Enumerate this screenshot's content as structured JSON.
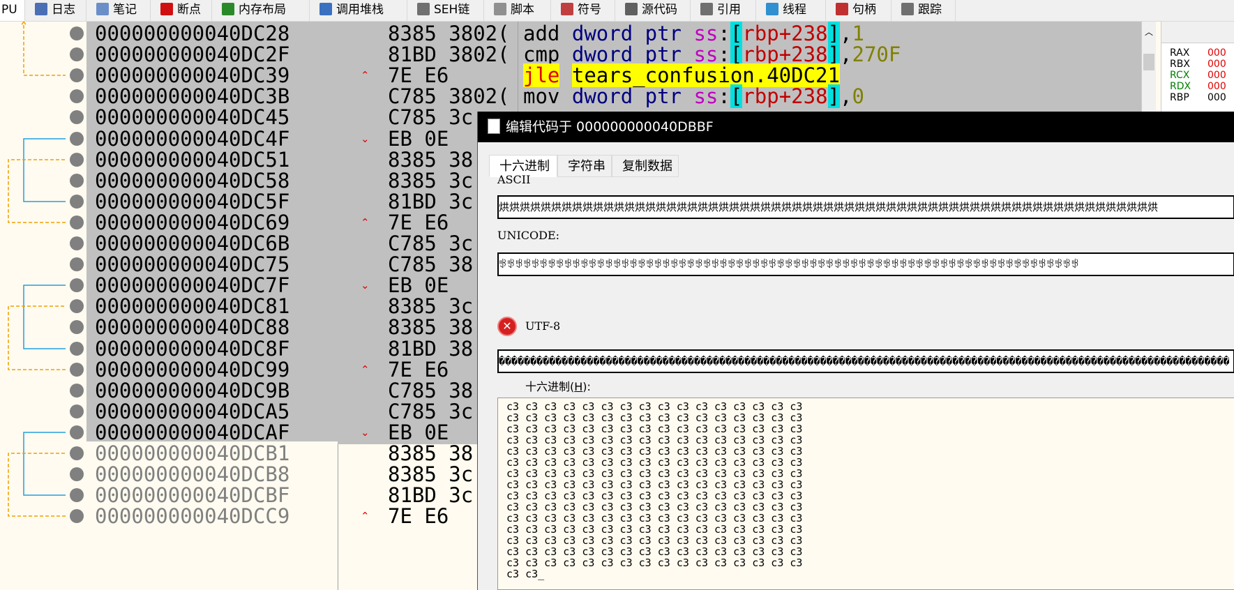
{
  "tabbar": {
    "first_label": "PU",
    "tabs": [
      {
        "label": "日志",
        "icon": "log-icon",
        "color": "#4a6fb5"
      },
      {
        "label": "笔记",
        "icon": "notes-icon",
        "color": "#6a8fc8"
      },
      {
        "label": "断点",
        "icon": "breakpoint-icon",
        "color": "#d01010"
      },
      {
        "label": "内存布局",
        "icon": "memory-map-icon",
        "color": "#2a8a2a"
      },
      {
        "label": "调用堆栈",
        "icon": "call-stack-icon",
        "color": "#3a70c0"
      },
      {
        "label": "SEH链",
        "icon": "seh-chain-icon",
        "color": "#707070"
      },
      {
        "label": "脚本",
        "icon": "script-icon",
        "color": "#909090"
      },
      {
        "label": "符号",
        "icon": "symbols-icon",
        "color": "#c04040"
      },
      {
        "label": "源代码",
        "icon": "source-icon",
        "color": "#606060"
      },
      {
        "label": "引用",
        "icon": "references-icon",
        "color": "#707070"
      },
      {
        "label": "线程",
        "icon": "threads-icon",
        "color": "#3090d0"
      },
      {
        "label": "句柄",
        "icon": "handles-icon",
        "color": "#c03030"
      },
      {
        "label": "跟踪",
        "icon": "trace-icon",
        "color": "#707070"
      }
    ]
  },
  "disasm": {
    "rows": [
      {
        "addr": "000000000040DC28",
        "bytes": "8385 3802(",
        "sel": true
      },
      {
        "addr": "000000000040DC2F",
        "bytes": "81BD 3802(",
        "sel": true
      },
      {
        "addr": "000000000040DC39",
        "bytes": "7E E6",
        "sel": true,
        "mark": "^"
      },
      {
        "addr": "000000000040DC3B",
        "bytes": "C785 3802(",
        "sel": true
      },
      {
        "addr": "000000000040DC45",
        "bytes": "C785 3c",
        "sel": true
      },
      {
        "addr": "000000000040DC4F",
        "bytes": "EB 0E",
        "sel": true,
        "mark": "v"
      },
      {
        "addr": "000000000040DC51",
        "bytes": "8385 38",
        "sel": true
      },
      {
        "addr": "000000000040DC58",
        "bytes": "8385 3c",
        "sel": true
      },
      {
        "addr": "000000000040DC5F",
        "bytes": "81BD 3c",
        "sel": true
      },
      {
        "addr": "000000000040DC69",
        "bytes": "7E E6",
        "sel": true,
        "mark": "^"
      },
      {
        "addr": "000000000040DC6B",
        "bytes": "C785 3c",
        "sel": true
      },
      {
        "addr": "000000000040DC75",
        "bytes": "C785 38",
        "sel": true
      },
      {
        "addr": "000000000040DC7F",
        "bytes": "EB 0E",
        "sel": true,
        "mark": "v"
      },
      {
        "addr": "000000000040DC81",
        "bytes": "8385 3c",
        "sel": true
      },
      {
        "addr": "000000000040DC88",
        "bytes": "8385 38",
        "sel": true
      },
      {
        "addr": "000000000040DC8F",
        "bytes": "81BD 38",
        "sel": true
      },
      {
        "addr": "000000000040DC99",
        "bytes": "7E E6",
        "sel": true,
        "mark": "^"
      },
      {
        "addr": "000000000040DC9B",
        "bytes": "C785 38",
        "sel": true
      },
      {
        "addr": "000000000040DCA5",
        "bytes": "C785 3c",
        "sel": true
      },
      {
        "addr": "000000000040DCAF",
        "bytes": "EB 0E",
        "sel": true,
        "mark": "v"
      },
      {
        "addr": "000000000040DCB1",
        "bytes": "8385 38",
        "sel": false
      },
      {
        "addr": "000000000040DCB8",
        "bytes": "8385 3c",
        "sel": false
      },
      {
        "addr": "000000000040DCBF",
        "bytes": "81BD 3c",
        "sel": false
      },
      {
        "addr": "000000000040DCC9",
        "bytes": "7E E6",
        "sel": false,
        "mark": "^"
      }
    ],
    "instructions": {
      "i0": {
        "mnemonic": "add",
        "size": "dword ptr",
        "seg": "ss",
        "reg": "rbp+238",
        "val": "1"
      },
      "i1": {
        "mnemonic": "cmp",
        "size": "dword ptr",
        "seg": "ss",
        "reg": "rbp+238",
        "val": "270F"
      },
      "i2": {
        "mnemonic": "jle",
        "target": "tears_confusion.40DC21"
      },
      "i3": {
        "mnemonic": "mov",
        "size": "dword ptr",
        "seg": "ss",
        "reg": "rbp+238",
        "val": "0"
      }
    }
  },
  "registers": [
    {
      "name": "RAX",
      "value": "000",
      "color": "#000000"
    },
    {
      "name": "RBX",
      "value": "000",
      "color": "#000000"
    },
    {
      "name": "RCX",
      "value": "000",
      "color": "#008000"
    },
    {
      "name": "RDX",
      "value": "000",
      "color": "#008000"
    },
    {
      "name": "RBP",
      "value": "000",
      "color": "#000000"
    }
  ],
  "dialog": {
    "title": "编辑代码于 000000000040DBBF",
    "tabs": [
      "十六进制",
      "字符串",
      "复制数据"
    ],
    "ascii_label": "ASCII",
    "ascii_value": "烘烘烘烘烘烘烘烘烘烘烘烘烘烘烘烘烘烘烘烘烘烘烘烘烘烘烘烘烘烘烘烘烘烘烘烘烘烘烘烘烘烘烘烘烘烘烘烘烘烘烘烘烘烘烘烘烘烘烘烘烘烘烘",
    "unicode_label": "UNICODE:",
    "unicode_value": "ꃃꃃꃃꃃꃃꃃꃃꃃꃃꃃꃃꃃꃃꃃꃃꃃꃃꃃꃃꃃꃃꃃꃃꃃꃃꃃꃃꃃꃃꃃꃃꃃꃃꃃꃃꃃꃃꃃꃃꃃꃃꃃꃃꃃꃃꃃꃃꃃꃃꃃꃃꃃꃃꃃꃃꃃꃃꃃꃃꃃꃃꃃꃃꃃꃃꃃꃃꃃꃃꃃꃃ",
    "utf8_label": "UTF-8",
    "utf8_value": "��������������������������������������������������������������������������������������������������������������������",
    "hex_label_pre": "十六进制(",
    "hex_label_key": "H",
    "hex_label_post": "):",
    "hex_byte": "c3",
    "hex_full_rows": 15,
    "hex_per_row": 16,
    "hex_last_row": "c3 c3"
  }
}
